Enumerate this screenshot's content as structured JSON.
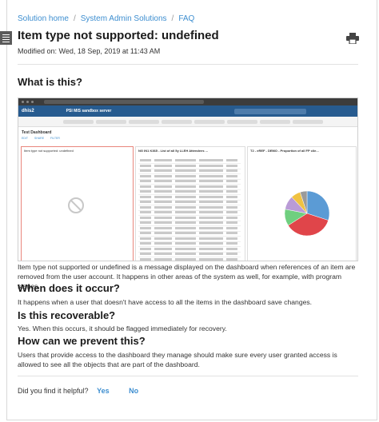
{
  "breadcrumb": {
    "items": [
      "Solution home",
      "System Admin Solutions",
      "FAQ"
    ]
  },
  "article": {
    "title": "Item type not supported: undefined",
    "modified": "Modified on: Wed, 18 Sep, 2019 at 11:43 AM"
  },
  "sections": [
    {
      "heading": "What is this?",
      "body": "Item type not supported or undefined is a message displayed on the dashboard when references of an item are removed from the user account. It happens in other areas of the system as well, for example, with program stages."
    },
    {
      "heading": "When does it occur?",
      "body": "It happens when a user that doesn't have access to all the items in the dashboard save changes."
    },
    {
      "heading": "Is this recoverable?",
      "body": "Yes. When this occurs, it should be flagged immediately for recovery."
    },
    {
      "heading": "How can we prevent this?",
      "body": "Users that provide access to the dashboard they manage should make sure every user granted access is allowed to see all the objects that are part of the dashboard."
    }
  ],
  "screenshot": {
    "app_logo": "dhis2",
    "server_name": "PSI MIS sandbox server",
    "dashboard_title": "Test Dashboard",
    "tabs": [
      "EDIT",
      "SHARE",
      "FILTER"
    ],
    "panel1_label": "Item type not supported: undefined",
    "panel2_label": "NG IN1 K365 - List of all 5y LLEH Attendees ...",
    "panel3_label": "T2 - eREF - DEMO - Proportion of all FP clie..."
  },
  "feedback": {
    "question": "Did you find it helpful?",
    "yes": "Yes",
    "no": "No"
  },
  "colors": {
    "link": "#3d8ed0",
    "pie": [
      "#5b9bd5",
      "#e0454a",
      "#6fcf7f",
      "#b99bd6",
      "#f0c242",
      "#9a9a9a"
    ]
  }
}
